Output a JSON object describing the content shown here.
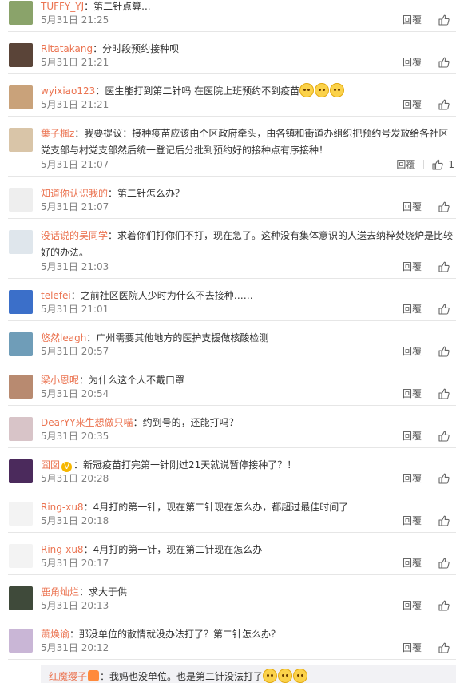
{
  "comments": [
    {
      "user": "TUFFY_YJ",
      "text": "第二针点算...",
      "time": "5月31日 21:25",
      "likes": "",
      "avatar_color": "#8aa36a"
    },
    {
      "user": "Ritatakang",
      "text": "分时段预约接种呗",
      "time": "5月31日 21:21",
      "likes": "",
      "avatar_color": "#5a4438"
    },
    {
      "user": "wyixiao123",
      "text": "医生能打到第二针吗 在医院上班预约不到疫苗",
      "emoji_count": 3,
      "time": "5月31日 21:21",
      "likes": "",
      "avatar_color": "#c9a27a"
    },
    {
      "user": "葉子楓z",
      "text": "我要提议：接种疫苗应该由个区政府牵头，由各镇和街道办组织把预约号发放给各社区党支部与村党支部然后统一登记后分批到预约好的接种点有序接种！",
      "time": "5月31日 21:07",
      "likes": "1",
      "avatar_color": "#d9c5a8"
    },
    {
      "user": "知道你认识我的",
      "text": "第二针怎么办？",
      "time": "5月31日 21:07",
      "likes": "",
      "avatar_color": "#eeeeee"
    },
    {
      "user": "没话说的吴同学",
      "text": "求着你们打你们不打，现在急了。这种没有集体意识的人送去纳粹焚烧炉是比较好的办法。",
      "time": "5月31日 21:03",
      "likes": "",
      "avatar_color": "#dfe6ec"
    },
    {
      "user": "telefei",
      "text": "之前社区医院人少时为什么不去接种……",
      "time": "5月31日 21:01",
      "likes": "",
      "avatar_color": "#3b6fc9"
    },
    {
      "user": "悠然leagh",
      "text": "广州需要其他地方的医护支援做核酸检测",
      "time": "5月31日 20:57",
      "likes": "",
      "avatar_color": "#6f9db8"
    },
    {
      "user": "梁小恩呢",
      "text": "为什么这个人不戴口罩",
      "time": "5月31日 20:54",
      "likes": "",
      "avatar_color": "#b88a70"
    },
    {
      "user": "DearYY来生想做只喵",
      "text": "约到号的，还能打吗？",
      "time": "5月31日 20:35",
      "likes": "",
      "avatar_color": "#d8c4c8"
    },
    {
      "user": "囧囡",
      "verified": true,
      "text": "新冠疫苗打完第一针刚过21天就说暂停接种了？！",
      "time": "5月31日 20:28",
      "likes": "",
      "avatar_color": "#4b2a5c"
    },
    {
      "user": "Ring-xu8",
      "text": "4月打的第一针，现在第二针现在怎么办，都超过最佳时间了",
      "time": "5月31日 20:18",
      "likes": "",
      "avatar_color": "#f3f3f3"
    },
    {
      "user": "Ring-xu8",
      "text": "4月打的第一针，现在第二针现在怎么办",
      "time": "5月31日 20:17",
      "likes": "",
      "avatar_color": "#f3f3f3"
    },
    {
      "user": "鹿角灿烂",
      "text": "求大于供",
      "time": "5月31日 20:13",
      "likes": "",
      "avatar_color": "#3f4a3a"
    },
    {
      "user": "萧焕谕",
      "text": "那没单位的散情就没办法打了？第二针怎么办？",
      "time": "5月31日 20:12",
      "likes": "",
      "avatar_color": "#c9b6d6"
    }
  ],
  "reply_label": "回覆",
  "like_icon": "thumbs-up-icon",
  "sub_reply": {
    "user": "红魔缨子",
    "text": "我妈也没单位。也是第二针没法打了",
    "emoji_count": 3
  },
  "colors": {
    "username": "#eb7350",
    "time": "#808080",
    "separator": "#e6e6e6",
    "subreply_bg": "#f2f2f5"
  }
}
